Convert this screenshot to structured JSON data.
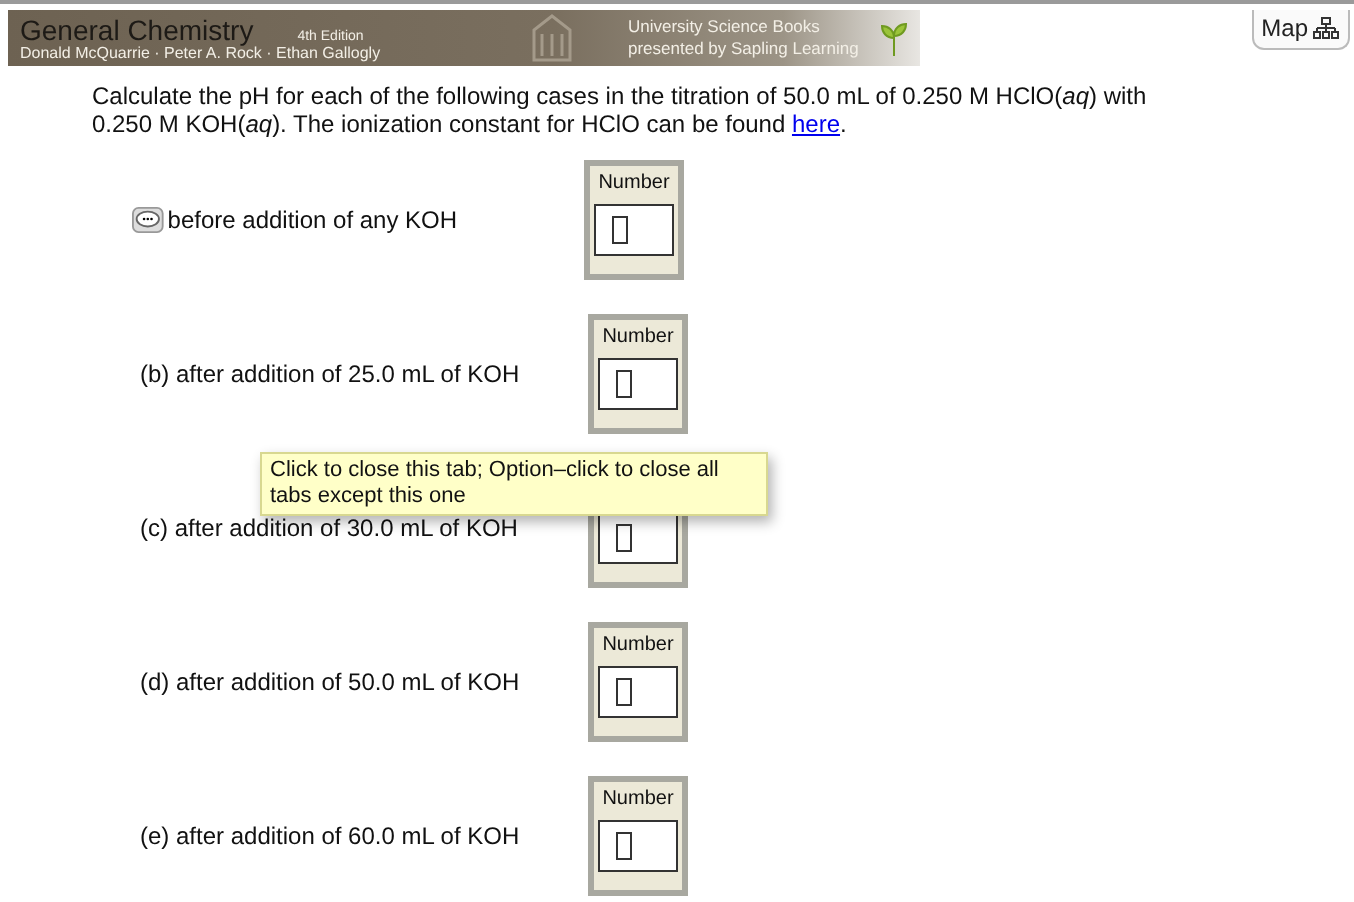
{
  "banner": {
    "title": "General Chemistry",
    "edition": "4th Edition",
    "authors": "Donald McQuarrie · Peter A. Rock · Ethan Gallogly",
    "publisher_line1": "University Science Books",
    "publisher_line2": "presented by Sapling Learning"
  },
  "map_button": {
    "label": "Map"
  },
  "question": "Calculate the pH for each of the following cases in the titration of 50.0 mL of 0.250 M HClO(*aq*) with 0.250 M KOH(*aq*). The ionization constant for HClO can be found ",
  "question_link": "here",
  "question_end": ".",
  "parts": [
    {
      "text": "before addition of any KOH",
      "hint_icon": true,
      "box_label": "Number"
    },
    {
      "text": "(b) after addition of 25.0 mL of KOH",
      "hint_icon": false,
      "box_label": "Number"
    },
    {
      "text": "(c) after addition of 30.0 mL of KOH",
      "hint_icon": false
    },
    {
      "text": "(d) after addition of 50.0 mL of KOH",
      "hint_icon": false,
      "box_label": "Number"
    },
    {
      "text": "(e) after addition of 60.0 mL of KOH",
      "hint_icon": false,
      "box_label": "Number"
    }
  ],
  "tooltip": "Click to close this tab; Option–click to close all tabs except this one"
}
